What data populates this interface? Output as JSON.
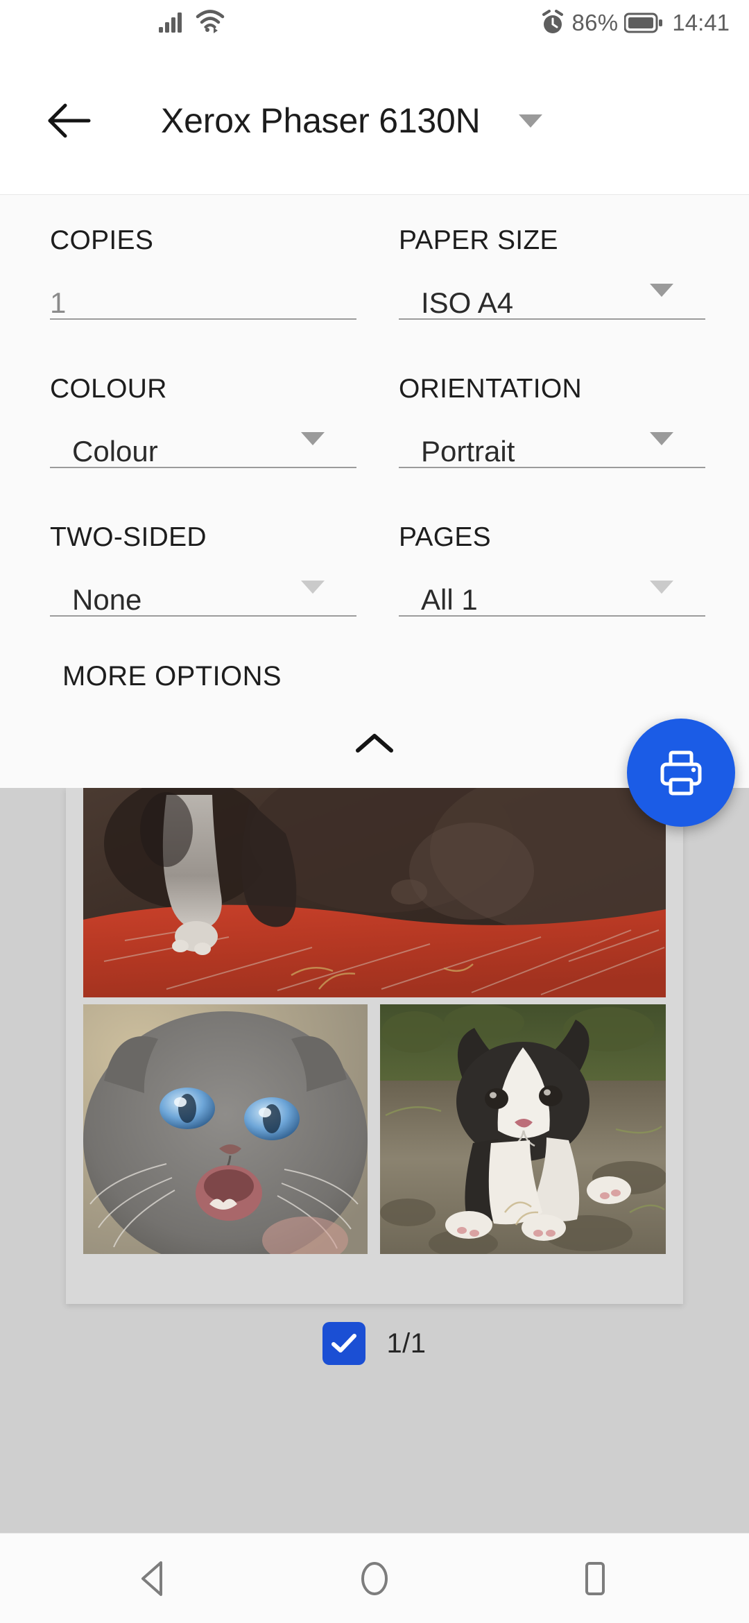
{
  "status_bar": {
    "signal_icon": "cellular-signal-icon",
    "wifi_icon": "wifi-icon",
    "alarm_icon": "alarm-clock-icon",
    "battery_percent": "86%",
    "battery_icon": "battery-icon",
    "time": "14:41"
  },
  "app_bar": {
    "back_icon": "back-arrow-icon",
    "title": "Xerox Phaser 6130N",
    "dropdown_icon": "chevron-down-icon"
  },
  "settings": {
    "fields": [
      {
        "label": "COPIES",
        "value": "1",
        "has_caret": false,
        "muted": true,
        "indent": false
      },
      {
        "label": "PAPER SIZE",
        "value": "ISO A4",
        "has_caret": true,
        "muted": false,
        "indent": true
      },
      {
        "label": "COLOUR",
        "value": "Colour",
        "has_caret": true,
        "muted": false,
        "indent": true
      },
      {
        "label": "ORIENTATION",
        "value": "Portrait",
        "has_caret": true,
        "muted": false,
        "indent": true
      },
      {
        "label": "TWO-SIDED",
        "value": "None",
        "has_caret": true,
        "muted": false,
        "indent": true
      },
      {
        "label": "PAGES",
        "value": "All 1",
        "has_caret": true,
        "muted": false,
        "indent": true
      }
    ],
    "more_options_label": "MORE OPTIONS",
    "collapse_icon": "chevron-up-icon"
  },
  "print_button": {
    "icon": "printer-icon",
    "color": "#1b5ce6"
  },
  "preview": {
    "photos": [
      {
        "name": "kitten-paws-on-red-board-photo"
      },
      {
        "name": "grey-kitten-blue-eyes-photo"
      },
      {
        "name": "black-white-kitten-on-soil-photo"
      }
    ],
    "page_selected": true,
    "page_count_label": "1/1",
    "checkbox_icon": "check-icon",
    "checkbox_color": "#1b4fd4"
  },
  "nav_bar": {
    "back_icon": "nav-back-triangle-icon",
    "home_icon": "nav-home-circle-icon",
    "recents_icon": "nav-recents-square-icon"
  }
}
